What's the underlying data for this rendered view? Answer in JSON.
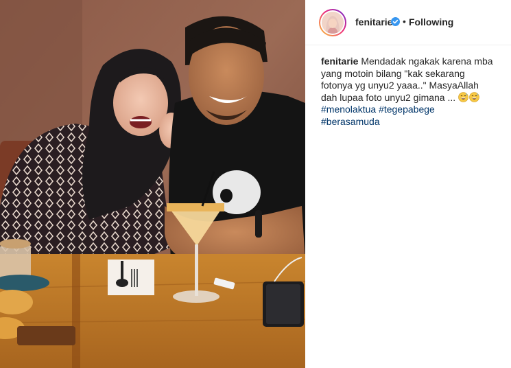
{
  "post": {
    "username": "fenitarie",
    "separator": "•",
    "follow_status": "Following",
    "caption": {
      "username": "fenitarie",
      "text": "Mendadak ngakak karena mba yang motoin bilang \"kak sekarang fotonya yg unyu2 yaaa..\" MasyaAllah dah lupaa foto unyu2 gimana ...",
      "emojis": [
        "grinning-sweat-emoji",
        "grinning-sweat-emoji"
      ],
      "hashtags": [
        "#menolaktua",
        "#tegepabege",
        "#berasamuda"
      ]
    }
  },
  "colors": {
    "text": "#262626",
    "hashtag": "#003569",
    "verified": "#3897f0",
    "divider": "#efefef"
  },
  "icons": {
    "verified": "verified-badge-icon",
    "avatar": "profile-avatar"
  }
}
